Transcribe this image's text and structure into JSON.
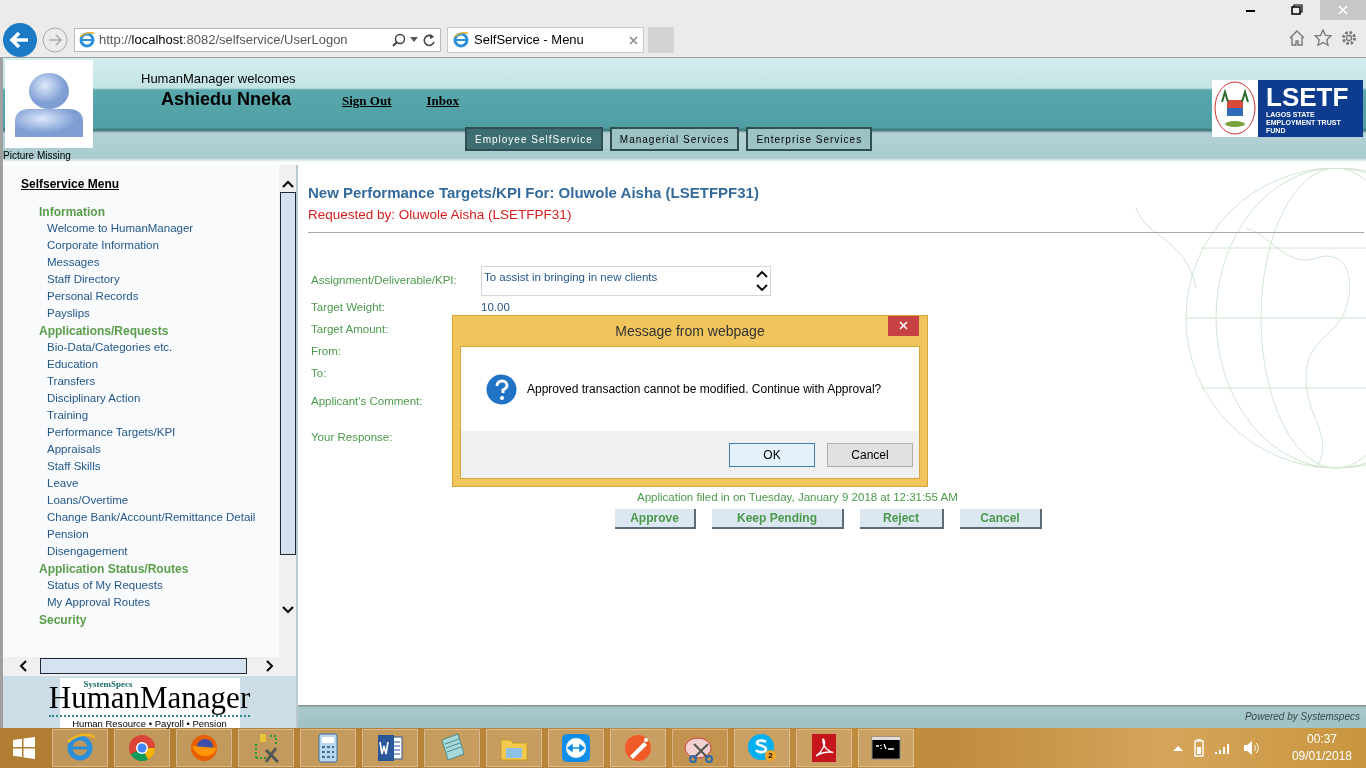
{
  "browser": {
    "url": "http://**localhost**:8082/selfservice/UserLogon",
    "tabs": [
      {
        "title": "SelfService - Menu",
        "selected": true
      }
    ]
  },
  "header": {
    "welcome": "HumanManager welcomes",
    "user": "Ashiedu Nneka",
    "links": [
      "Sign Out",
      "Inbox"
    ],
    "picture_caption": "Picture Missing",
    "nav": [
      {
        "label": "Employee SelfService",
        "selected": true
      },
      {
        "label": "Managerial Services",
        "selected": false
      },
      {
        "label": "Enterprise Services",
        "selected": false
      }
    ],
    "logo": {
      "name": "LSETF",
      "subtitle": "LAGOS STATE EMPLOYMENT TRUST FUND"
    }
  },
  "sidebar": {
    "title": "Selfservice Menu",
    "items": [
      {
        "label": "Information",
        "kind": "section"
      },
      {
        "label": "Welcome to HumanManager",
        "kind": "link"
      },
      {
        "label": "Corporate Information",
        "kind": "link"
      },
      {
        "label": "Messages",
        "kind": "link"
      },
      {
        "label": "Staff Directory",
        "kind": "link"
      },
      {
        "label": "Personal Records",
        "kind": "link"
      },
      {
        "label": "Payslips",
        "kind": "link"
      },
      {
        "label": "Applications/Requests",
        "kind": "section"
      },
      {
        "label": "Bio-Data/Categories etc.",
        "kind": "link"
      },
      {
        "label": "Education",
        "kind": "link"
      },
      {
        "label": "Transfers",
        "kind": "link"
      },
      {
        "label": "Disciplinary Action",
        "kind": "link"
      },
      {
        "label": "Training",
        "kind": "link"
      },
      {
        "label": "Performance Targets/KPI",
        "kind": "link"
      },
      {
        "label": "Appraisals",
        "kind": "link"
      },
      {
        "label": "Staff Skills",
        "kind": "link"
      },
      {
        "label": "Leave",
        "kind": "link"
      },
      {
        "label": "Loans/Overtime",
        "kind": "link"
      },
      {
        "label": "Change Bank/Account/Remittance Detail",
        "kind": "link"
      },
      {
        "label": "Pension",
        "kind": "link"
      },
      {
        "label": "Disengagement",
        "kind": "link"
      },
      {
        "label": "Application Status/Routes",
        "kind": "section"
      },
      {
        "label": "Status of My Requests",
        "kind": "link"
      },
      {
        "label": "My Approval Routes",
        "kind": "link"
      },
      {
        "label": "Security",
        "kind": "section"
      }
    ],
    "logo": {
      "brand": "SystemSpecs",
      "name": "HumanManager",
      "tagline": "Human Resource • Payroll • Pension"
    }
  },
  "main": {
    "title": "New Performance Targets/KPI For: Oluwole Aisha (LSETFPF31)",
    "requested_by": "Requested by: Oluwole Aisha (LSETFPF31)",
    "fields": [
      {
        "label": "Assignment/Deliverable/KPI:",
        "value": "To assist in bringing in new clients",
        "kind": "textarea"
      },
      {
        "label": "Target Weight:",
        "value": "10.00",
        "kind": "text"
      },
      {
        "label": "Target Amount:",
        "kind": "text"
      },
      {
        "label": "From:",
        "kind": "text"
      },
      {
        "label": "To:",
        "kind": "text"
      },
      {
        "label": "Applicant's Comment:",
        "kind": "text"
      },
      {
        "label": "Your Response:",
        "kind": "text"
      }
    ],
    "filed": "Application filed in on  Tuesday, January 9 2018 at 12:31:55 AM",
    "buttons": [
      "Approve",
      "Keep Pending",
      "Reject",
      "Cancel"
    ]
  },
  "footer": "Powered by Systemspecs",
  "dialog": {
    "title": "Message from webpage",
    "message": "Approved transaction cannot be modified. Continue with Approval?",
    "buttons": [
      {
        "label": "OK",
        "selected": true
      },
      {
        "label": "Cancel",
        "selected": false
      }
    ]
  },
  "taskbar": {
    "badge": "2",
    "time": "00:37",
    "date": "09/01/2018"
  }
}
